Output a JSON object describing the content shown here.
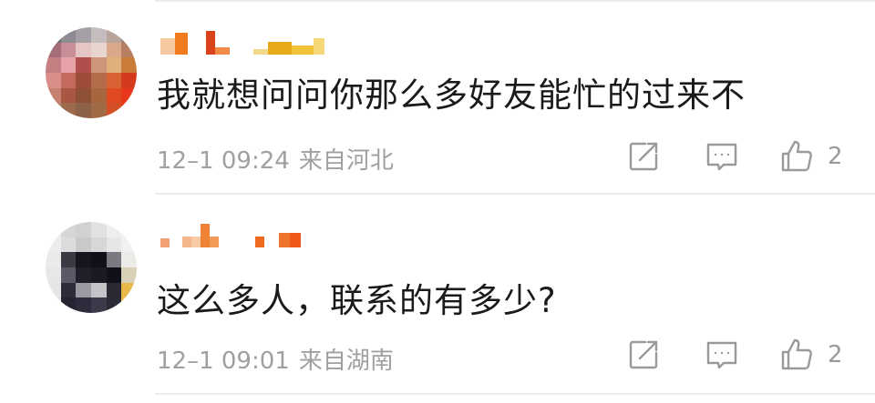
{
  "comments": [
    {
      "text": "我就想问问你那么多好友能忙的过来不",
      "time": "12–1 09:24",
      "location": "来自河北",
      "likes": "2",
      "avatar_icon": "pixelated-avatar-icon",
      "username_icon": "pixelated-username-icon"
    },
    {
      "text": "这么多人，联系的有多少?",
      "time": "12–1 09:01",
      "location": "来自湖南",
      "likes": "2",
      "avatar_icon": "pixelated-avatar-icon",
      "username_icon": "pixelated-username-icon"
    }
  ],
  "icons": {
    "share": "share-icon",
    "comment": "comment-icon",
    "like": "thumbs-up-icon"
  },
  "colors": {
    "text": "#1a1a1a",
    "meta": "#a0a0a0",
    "icon": "#9a9a9a",
    "divider": "#ececec"
  }
}
